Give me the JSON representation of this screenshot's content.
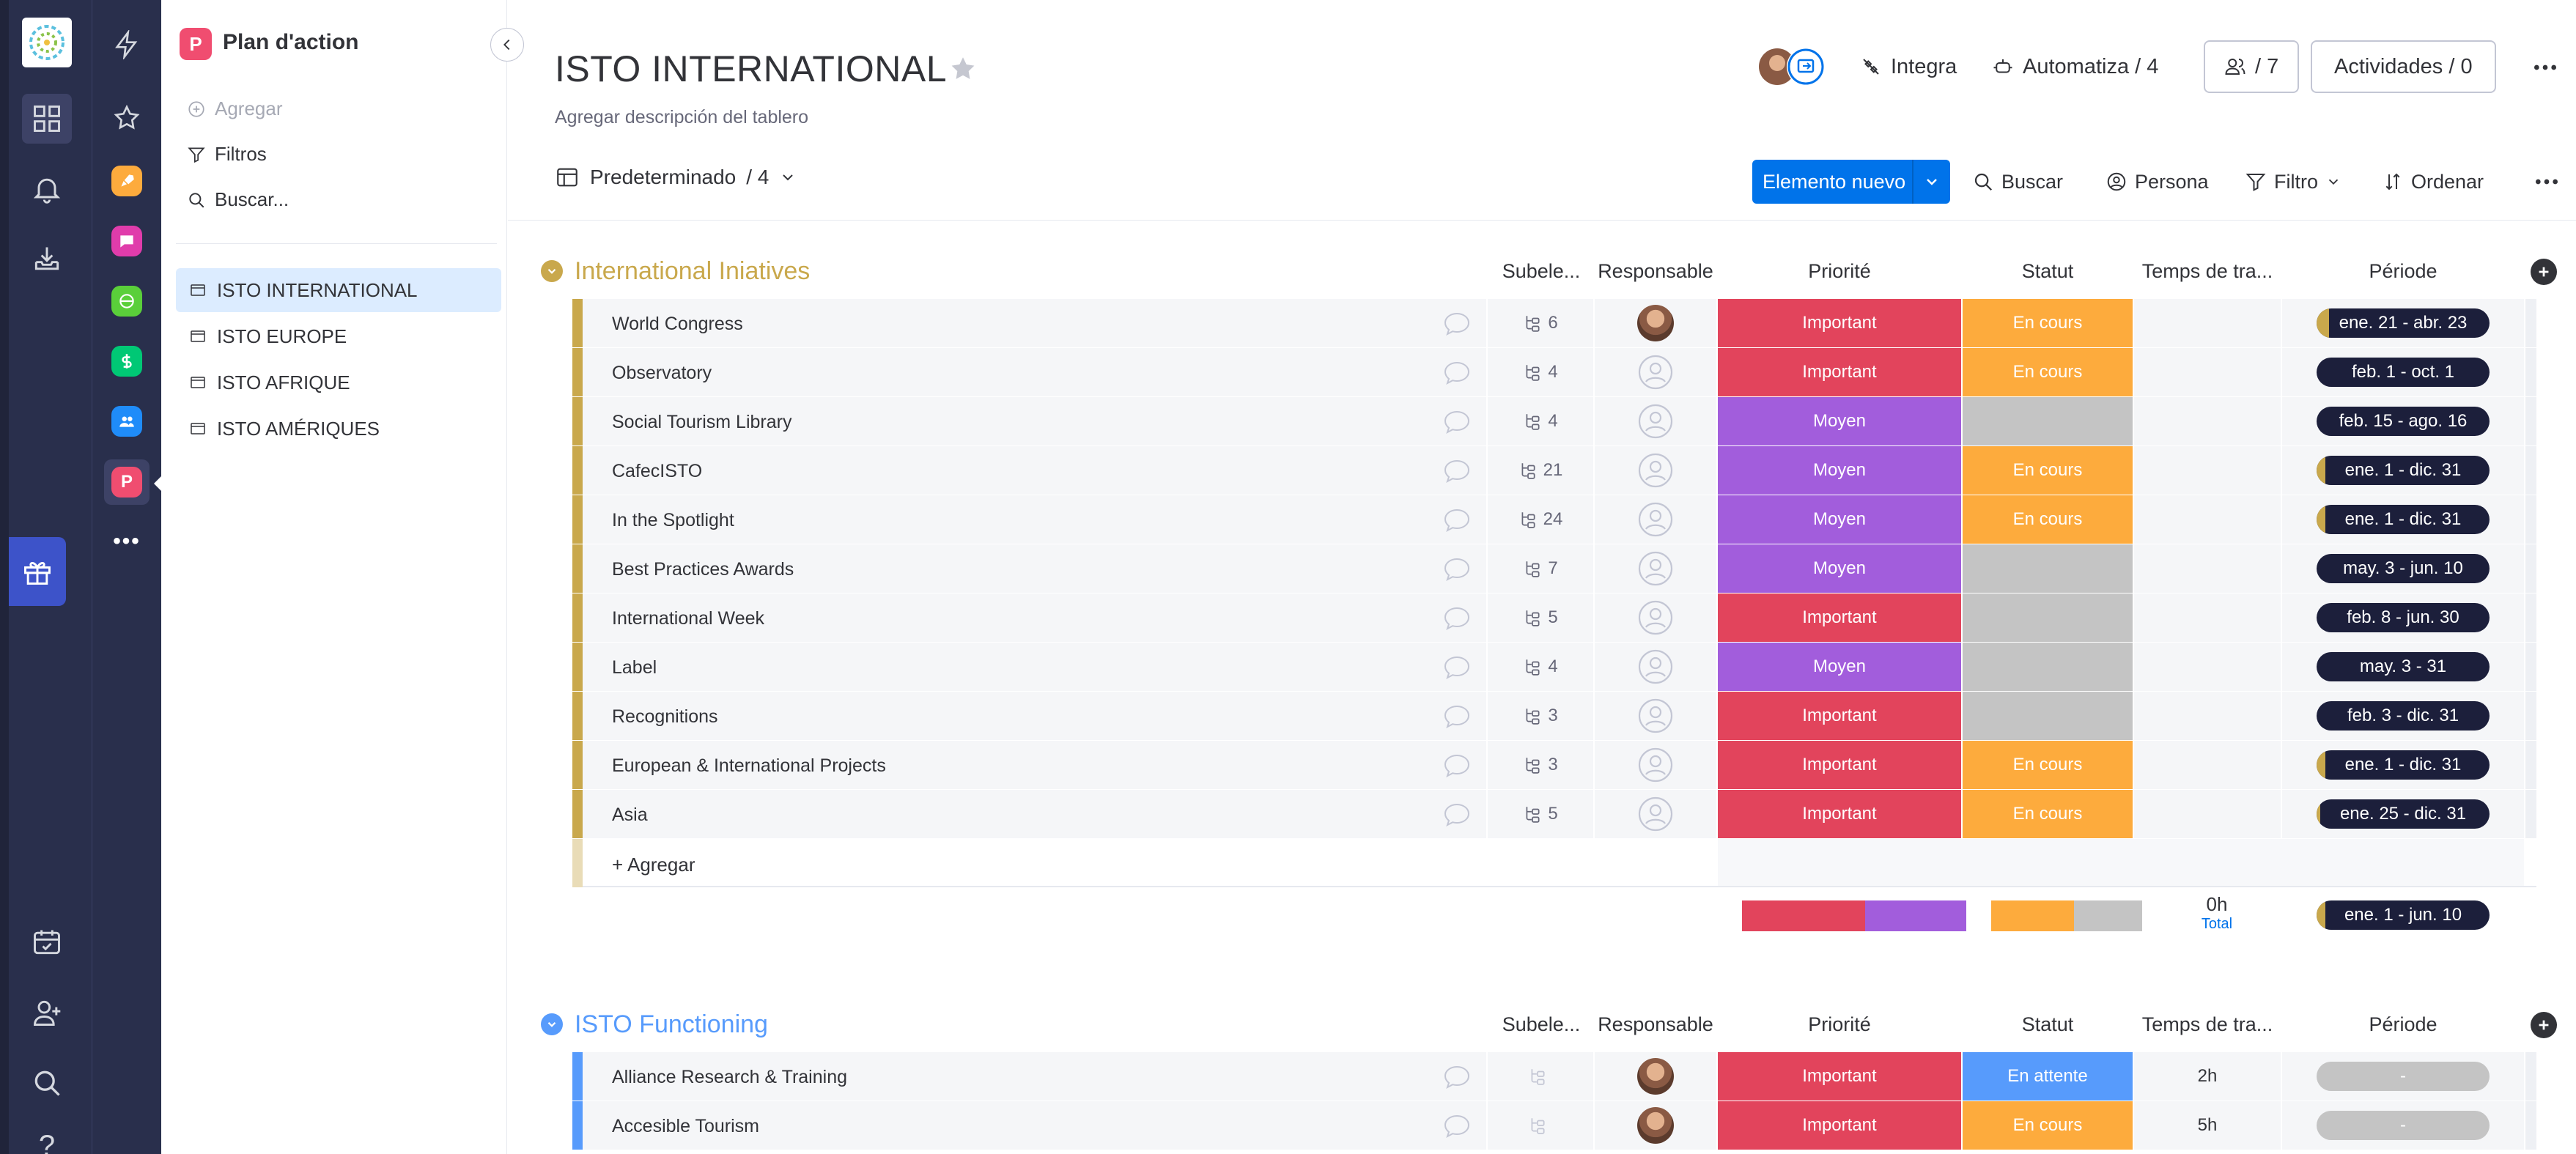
{
  "rail": {
    "icons": [
      "grid-icon",
      "bell-icon",
      "inbox-icon",
      "gift-icon",
      "calendar-check-icon",
      "add-user-icon",
      "search-icon",
      "help-icon"
    ],
    "help_label": "?"
  },
  "apps": {
    "active_badge": "P",
    "more": "•••"
  },
  "workspace": {
    "badge": "P",
    "title": "Plan d'action",
    "add_label": "Agregar",
    "filters_label": "Filtros",
    "search_label": "Buscar...",
    "boards": [
      {
        "label": "ISTO INTERNATIONAL",
        "active": true
      },
      {
        "label": "ISTO EUROPE",
        "active": false
      },
      {
        "label": "ISTO AFRIQUE",
        "active": false
      },
      {
        "label": "ISTO AMÉRIQUES",
        "active": false
      }
    ]
  },
  "board": {
    "title": "ISTO INTERNATIONAL",
    "description": "Agregar descripción del tablero",
    "integrate_label": "Integra",
    "automate_label": "Automatiza / 4",
    "members_label": "/ 7",
    "activities_label": "Actividades / 0",
    "view_label": "Predeterminado",
    "view_count": "/ 4",
    "new_item_label": "Elemento nuevo",
    "search_label": "Buscar",
    "person_label": "Persona",
    "filter_label": "Filtro",
    "sort_label": "Ordenar"
  },
  "columns": {
    "subitems": "Subele...",
    "owner": "Responsable",
    "priority": "Priorité",
    "status": "Statut",
    "time": "Temps de tra...",
    "period": "Période"
  },
  "colors": {
    "important": "#e2445c",
    "moyen": "#a25ddc",
    "en_cours": "#fdab3d",
    "en_attente": "#579bfc",
    "empty_status": "#c4c4c4",
    "group1": "#c9a84c",
    "group2": "#579bfc"
  },
  "groups": [
    {
      "title": "International Iniatives",
      "color": "#c9a84c",
      "add_label": "+ Agregar",
      "summary_time": "0h",
      "summary_time_label": "Total",
      "summary_period": "ene. 1 - jun. 10",
      "summary_period_progress": 0.05,
      "summary_priority": [
        {
          "color": "#e2445c",
          "share": 0.55
        },
        {
          "color": "#a25ddc",
          "share": 0.45
        }
      ],
      "summary_status": [
        {
          "color": "#fdab3d",
          "share": 0.55
        },
        {
          "color": "#c4c4c4",
          "share": 0.45
        }
      ],
      "rows": [
        {
          "name": "World Congress",
          "subitems": "6",
          "owner": "photo",
          "priority": "Important",
          "priority_color": "#e2445c",
          "status": "En cours",
          "status_color": "#fdab3d",
          "time": "",
          "period": "ene. 21 - abr. 23",
          "progress": 0.07
        },
        {
          "name": "Observatory",
          "subitems": "4",
          "owner": "empty",
          "priority": "Important",
          "priority_color": "#e2445c",
          "status": "En cours",
          "status_color": "#fdab3d",
          "time": "",
          "period": "feb. 1 - oct. 1",
          "progress": 0
        },
        {
          "name": "Social Tourism Library",
          "subitems": "4",
          "owner": "empty",
          "priority": "Moyen",
          "priority_color": "#a25ddc",
          "status": "",
          "status_color": "#c4c4c4",
          "time": "",
          "period": "feb. 15 - ago. 16",
          "progress": 0
        },
        {
          "name": "CafecISTO",
          "subitems": "21",
          "owner": "empty",
          "priority": "Moyen",
          "priority_color": "#a25ddc",
          "status": "En cours",
          "status_color": "#fdab3d",
          "time": "",
          "period": "ene. 1 - dic. 31",
          "progress": 0.05
        },
        {
          "name": "In the Spotlight",
          "subitems": "24",
          "owner": "empty",
          "priority": "Moyen",
          "priority_color": "#a25ddc",
          "status": "En cours",
          "status_color": "#fdab3d",
          "time": "",
          "period": "ene. 1 - dic. 31",
          "progress": 0.05
        },
        {
          "name": "Best Practices Awards",
          "subitems": "7",
          "owner": "empty",
          "priority": "Moyen",
          "priority_color": "#a25ddc",
          "status": "",
          "status_color": "#c4c4c4",
          "time": "",
          "period": "may. 3 - jun. 10",
          "progress": 0
        },
        {
          "name": "International Week",
          "subitems": "5",
          "owner": "empty",
          "priority": "Important",
          "priority_color": "#e2445c",
          "status": "",
          "status_color": "#c4c4c4",
          "time": "",
          "period": "feb. 8 - jun. 30",
          "progress": 0
        },
        {
          "name": "Label",
          "subitems": "4",
          "owner": "empty",
          "priority": "Moyen",
          "priority_color": "#a25ddc",
          "status": "",
          "status_color": "#c4c4c4",
          "time": "",
          "period": "may. 3 - 31",
          "progress": 0
        },
        {
          "name": "Recognitions",
          "subitems": "3",
          "owner": "empty",
          "priority": "Important",
          "priority_color": "#e2445c",
          "status": "",
          "status_color": "#c4c4c4",
          "time": "",
          "period": "feb. 3 - dic. 31",
          "progress": 0
        },
        {
          "name": "European & International Projects",
          "subitems": "3",
          "owner": "empty",
          "priority": "Important",
          "priority_color": "#e2445c",
          "status": "En cours",
          "status_color": "#fdab3d",
          "time": "",
          "period": "ene. 1 - dic. 31",
          "progress": 0.05
        },
        {
          "name": "Asia",
          "subitems": "5",
          "owner": "empty",
          "priority": "Important",
          "priority_color": "#e2445c",
          "status": "En cours",
          "status_color": "#fdab3d",
          "time": "",
          "period": "ene. 25 - dic. 31",
          "progress": 0.02
        }
      ]
    },
    {
      "title": "ISTO Functioning",
      "color": "#579bfc",
      "rows": [
        {
          "name": "Alliance Research & Training",
          "subitems": "",
          "owner": "photo",
          "priority": "Important",
          "priority_color": "#e2445c",
          "status": "En attente",
          "status_color": "#579bfc",
          "time": "2h",
          "period": "-",
          "progress": 0
        },
        {
          "name": "Accesible Tourism",
          "subitems": "",
          "owner": "photo",
          "priority": "Important",
          "priority_color": "#e2445c",
          "status": "En cours",
          "status_color": "#fdab3d",
          "time": "5h",
          "period": "-",
          "progress": 0
        }
      ]
    }
  ]
}
